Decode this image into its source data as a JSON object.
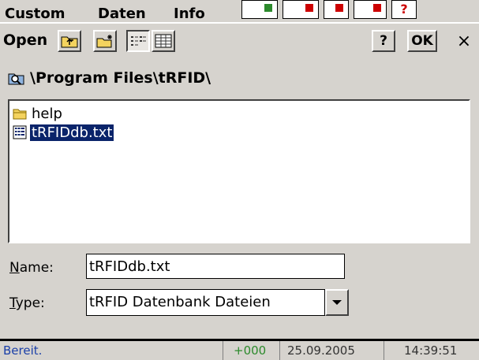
{
  "background_app": {
    "menu": [
      "Custom",
      "Daten",
      "Info"
    ]
  },
  "dialog": {
    "title": "Open",
    "help_label": "?",
    "ok_label": "OK",
    "close_label": "×",
    "path": "\\Program Files\\tRFID\\",
    "files": [
      {
        "name": "help",
        "icon": "folder-icon",
        "selected": false
      },
      {
        "name": "tRFIDdb.txt",
        "icon": "database-file-icon",
        "selected": true
      }
    ],
    "name_label_accel": "N",
    "name_label_rest": "ame:",
    "name_value": "tRFIDdb.txt",
    "type_label_accel": "T",
    "type_label_rest": "ype:",
    "type_value": "tRFID Datenbank Dateien"
  },
  "statusbar": {
    "status": "Bereit.",
    "counter": "+000",
    "date": "25.09.2005",
    "time": "14:39:51"
  },
  "colors": {
    "window": "#d6d3ce",
    "selection": "#0a246a",
    "status_text": "#1a3fa8",
    "counter_text": "#2c8a2c"
  }
}
